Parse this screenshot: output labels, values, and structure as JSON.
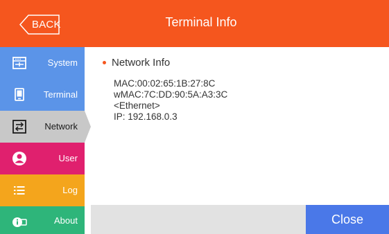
{
  "header": {
    "back_label": "BACK",
    "title": "Terminal Info"
  },
  "sidebar": {
    "items": [
      {
        "label": "System",
        "icon": "system-icon",
        "color": "#5b94e8"
      },
      {
        "label": "Terminal",
        "icon": "terminal-icon",
        "color": "#5b94e8"
      },
      {
        "label": "Network",
        "icon": "network-icon",
        "color": "#c8c8c8",
        "active": true
      },
      {
        "label": "User",
        "icon": "user-icon",
        "color": "#e0206e"
      },
      {
        "label": "Log",
        "icon": "log-icon",
        "color": "#f4a51c"
      },
      {
        "label": "About",
        "icon": "about-icon",
        "color": "#2eb57a"
      }
    ]
  },
  "content": {
    "section_title": "Network Info",
    "lines": [
      "MAC:00:02:65:1B:27:8C",
      "wMAC:7C:DD:90:5A:A3:3C",
      "<Ethernet>",
      "IP: 192.168.0.3"
    ]
  },
  "footer": {
    "close_label": "Close"
  },
  "colors": {
    "header": "#f5561e",
    "close_button": "#4a78e8",
    "footer_bar": "#e2e2e2"
  }
}
